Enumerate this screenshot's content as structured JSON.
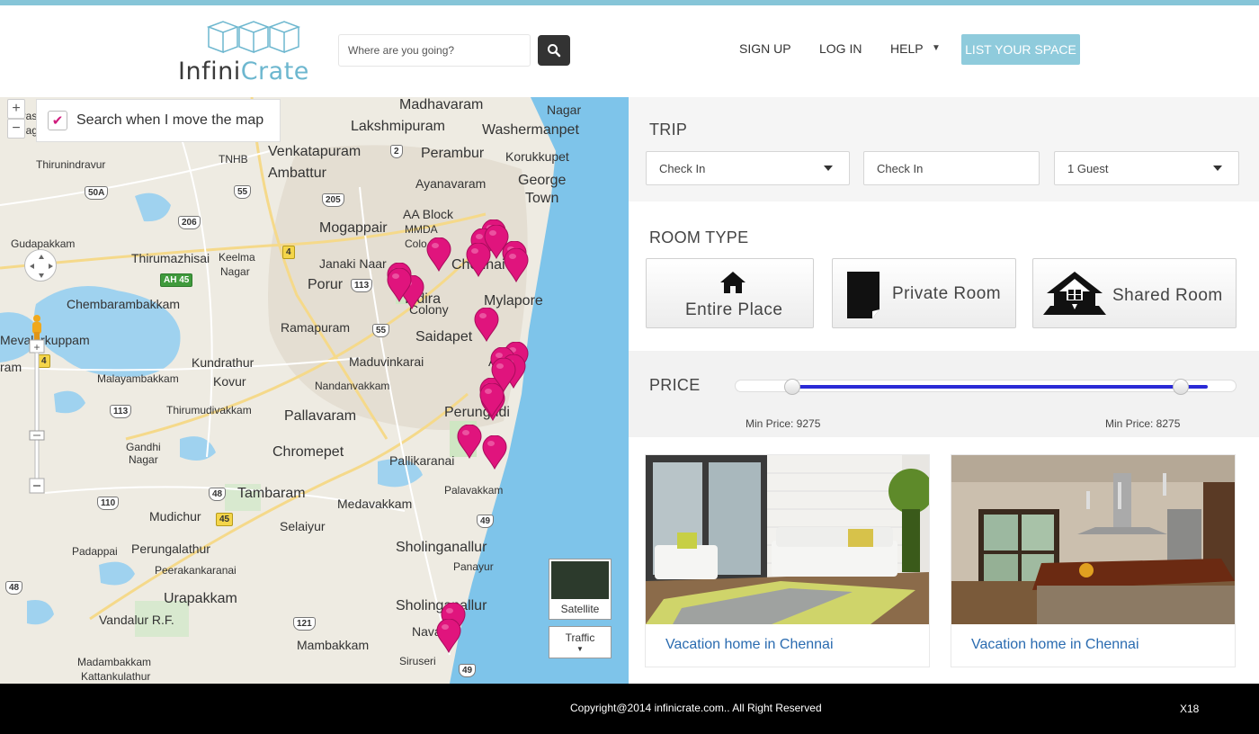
{
  "header": {
    "logo": {
      "part1": "Infini",
      "part2": "Crate"
    },
    "search": {
      "placeholder": "Where are you going?"
    },
    "nav": {
      "signup": "SIGN UP",
      "login": "LOG IN",
      "help": "HELP",
      "list_space": "LIST YOUR SPACE"
    }
  },
  "map": {
    "search_when_move": "Search when I move the map",
    "satellite": "Satellite",
    "traffic": "Traffic",
    "labels": [
      "Madhavaram",
      "Nagar",
      "Saraswati",
      "Nagar",
      "Lakshmipuram",
      "Washermanpet",
      "Venkatapuram",
      "Perambur",
      "Korukkupet",
      "TNHB",
      "Ambattur",
      "Thirunindravur",
      "Ayanavaram",
      "George",
      "Town",
      "AA Block",
      "MMDA",
      "Colo",
      "Gudapakkam",
      "Mogappair",
      "Thirumazhisai",
      "Keelma",
      "Nagar",
      "Janaki Naar",
      "Chennai",
      "Porur",
      "Indira",
      "Colony",
      "Mylapore",
      "Chembarambakkam",
      "Ramapuram",
      "Saidapet",
      "Mevalurkuppam",
      "Kundrathur",
      "Maduvinkarai",
      "Adyar",
      "ram",
      "Malayambakkam",
      "Kovur",
      "Nandanvakkam",
      "Thirumudivakkam",
      "Pallavaram",
      "Perungudi",
      "Gandhi",
      "Nagar",
      "Chromepet",
      "Pallikaranai",
      "Tambaram",
      "Palavakkam",
      "Mudichur",
      "Medavakkam",
      "Selaiyur",
      "Padappai",
      "Perungalathur",
      "Sholinganallur",
      "Peerakankaranai",
      "Panayur",
      "Urapakkam",
      "Sholinganallur",
      "Vandalur R.F.",
      "Navalur",
      "Mambakkam",
      "Siruseri",
      "Madambakkam",
      "Kattankulathur"
    ],
    "shields": [
      "2",
      "50A",
      "55",
      "205",
      "206",
      "4",
      "AH 45",
      "113",
      "55",
      "4",
      "113",
      "48",
      "110",
      "45",
      "49",
      "48",
      "121",
      "49"
    ],
    "pins_count": 22
  },
  "filters": {
    "trip": {
      "title": "TRIP",
      "check_in": "Check In",
      "check_out": "Check In",
      "guests": "1 Guest"
    },
    "room_type": {
      "title": "ROOM TYPE",
      "options": [
        "Entire Place",
        "Private Room",
        "Shared Room"
      ]
    },
    "price": {
      "title": "PRICE",
      "min_label": "Min Price: 9275",
      "max_label": "Min Price: 8275",
      "range_fraction": [
        0.1,
        0.9
      ]
    }
  },
  "listings": [
    {
      "title": "Vacation home in Chennai"
    },
    {
      "title": "Vacation home in Chennai"
    }
  ],
  "footer": {
    "copyright": "Copyright@2014 infinicrate.com.. All Right Reserved",
    "badge": "X18"
  },
  "colors": {
    "accent": "#86c5d8",
    "pin": "#e0147d",
    "slider": "#2a2ad6",
    "link": "#2a6bb0"
  }
}
